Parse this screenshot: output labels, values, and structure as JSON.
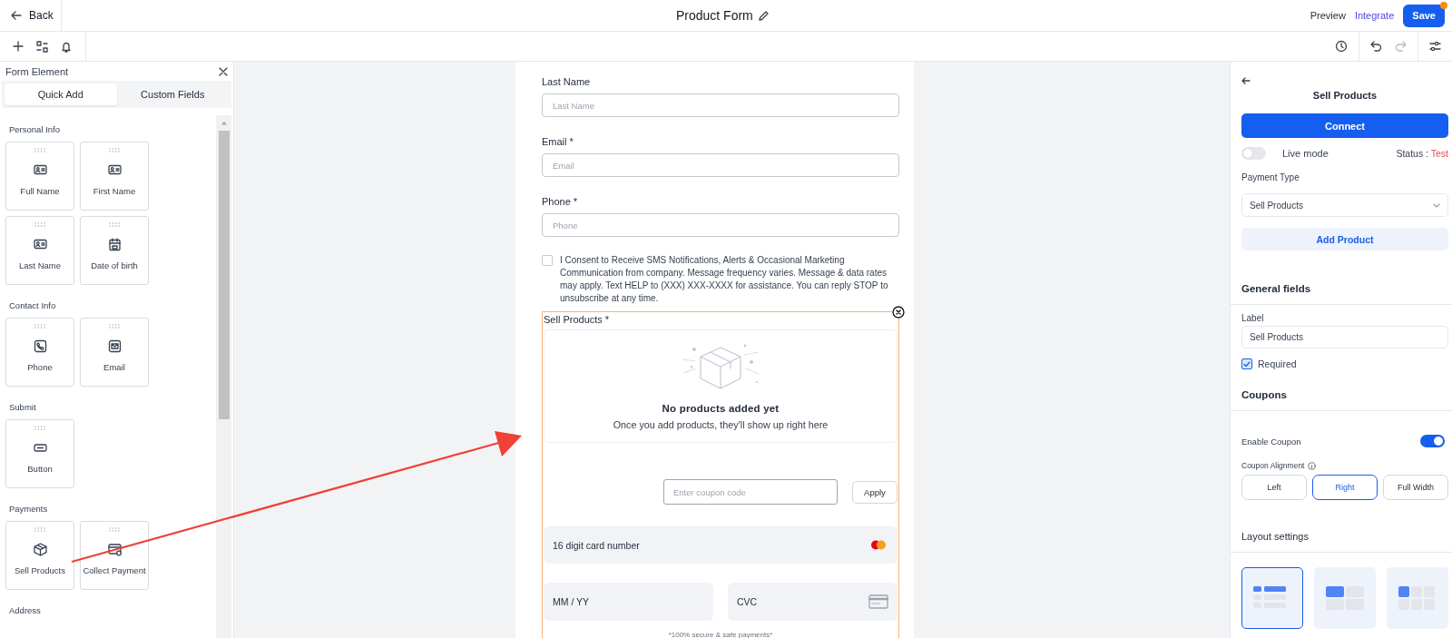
{
  "topbar": {
    "back": "Back",
    "title": "Product Form",
    "preview": "Preview",
    "integrate": "Integrate",
    "save": "Save",
    "unsaved": true
  },
  "toolbar": {
    "redo_disabled": true
  },
  "panel": {
    "title": "Form Element",
    "tabs": [
      {
        "label": "Quick Add",
        "selected": true
      },
      {
        "label": "Custom Fields",
        "selected": false
      }
    ],
    "sections": [
      {
        "title": "Personal Info",
        "items": [
          {
            "label": "Full Name",
            "kind": "contact-card"
          },
          {
            "label": "First Name",
            "kind": "contact-card"
          },
          {
            "label": "Last Name",
            "kind": "contact-card"
          },
          {
            "label": "Date of birth",
            "kind": "calendar"
          }
        ]
      },
      {
        "title": "Contact Info",
        "items": [
          {
            "label": "Phone",
            "kind": "phone"
          },
          {
            "label": "Email",
            "kind": "mail"
          }
        ]
      },
      {
        "title": "Submit",
        "items": [
          {
            "label": "Button",
            "kind": "button"
          }
        ]
      },
      {
        "title": "Payments",
        "items": [
          {
            "label": "Sell Products",
            "kind": "box"
          },
          {
            "label": "Collect Payment",
            "kind": "card"
          }
        ]
      },
      {
        "title": "Address"
      }
    ]
  },
  "form": {
    "fields": [
      {
        "label": "Last Name",
        "placeholder": "Last Name"
      },
      {
        "label": "Email *",
        "placeholder": "Email"
      },
      {
        "label": "Phone *",
        "placeholder": "Phone"
      }
    ],
    "consent": {
      "checked": false,
      "text": "I Consent to Receive SMS Notifications, Alerts & Occasional Marketing Communication from company. Message frequency varies. Message & data rates may apply. Text HELP to (XXX) XXX-XXXX for assistance. You can reply STOP to unsubscribe at any time."
    },
    "products": {
      "selected": true,
      "label": "Sell Products *",
      "empty_title": "No products added yet",
      "empty_text": "Once you add products, they'll show up right here",
      "coupon_placeholder": "Enter coupon code",
      "apply": "Apply",
      "card_number": "16 digit card number",
      "expiry": "MM / YY",
      "cvc": "CVC",
      "note": "*100% secure & safe payments*"
    }
  },
  "settings": {
    "title": "Sell Products",
    "connect": "Connect",
    "live_mode": {
      "label": "Live mode",
      "on": false
    },
    "status_label": "Status :",
    "status_value": "Test",
    "payment_type": {
      "label": "Payment Type",
      "value": "Sell Products"
    },
    "add_product": "Add Product",
    "general_heading": "General fields",
    "label_field": {
      "label": "Label",
      "value": "Sell Products"
    },
    "required": {
      "label": "Required",
      "checked": true
    },
    "coupons_heading": "Coupons",
    "enable_coupon": {
      "label": "Enable Coupon",
      "on": true
    },
    "alignment_label": "Coupon Alignment",
    "alignments": [
      {
        "label": "Left",
        "selected": false
      },
      {
        "label": "Right",
        "selected": true
      },
      {
        "label": "Full Width",
        "selected": false
      }
    ],
    "layout_heading": "Layout settings",
    "layouts": [
      {
        "kind": "list",
        "selected": true
      },
      {
        "kind": "large-grid",
        "selected": false
      },
      {
        "kind": "small-grid",
        "selected": false
      }
    ]
  }
}
